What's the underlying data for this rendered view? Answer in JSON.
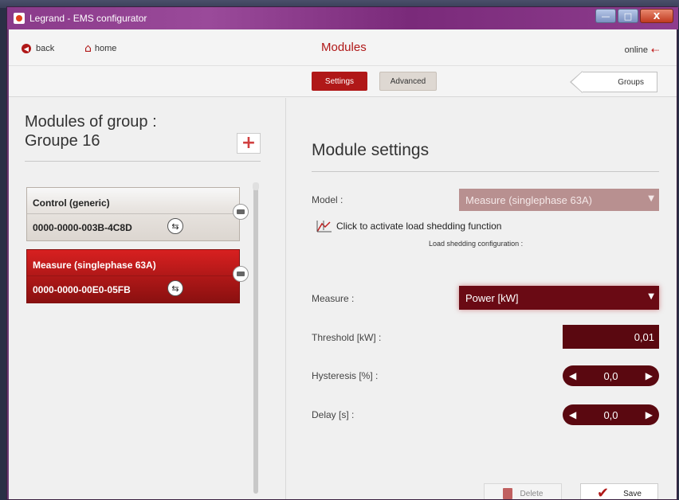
{
  "window": {
    "title": "Legrand - EMS configurator",
    "minimize": "—",
    "maximize": "□",
    "close": "X"
  },
  "topbar": {
    "back_label": "back",
    "home_label": "home",
    "page_title": "Modules",
    "status": "online",
    "tabs": [
      {
        "label": "Settings",
        "active": true
      },
      {
        "label": "Advanced",
        "active": false
      }
    ],
    "groups_label": "Groups"
  },
  "left": {
    "title_line1": "Modules of group :",
    "title_line2": "Groupe  16",
    "add_glyph": "+",
    "modules": [
      {
        "name": "Control (generic)",
        "id": "0000-0000-003B-4C8D",
        "selected": false
      },
      {
        "name": "Measure (singlephase 63A)",
        "id": "0000-0000-00E0-05FB",
        "selected": true
      }
    ]
  },
  "right": {
    "title": "Module settings",
    "model_label": "Model :",
    "model_value": "Measure (singlephase 63A)",
    "shed_link": "Click to activate load shedding function",
    "shed_config": "Load shedding configuration :",
    "measure_label": "Measure :",
    "measure_value": "Power [kW]",
    "threshold_label": "Threshold [kW] :",
    "threshold_value": "0,01",
    "hysteresis_label": "Hysteresis [%] :",
    "hysteresis_value": "0,0",
    "delay_label": "Delay [s] :",
    "delay_value": "0,0",
    "delete_label": "Delete",
    "save_label": "Save"
  },
  "colors": {
    "accent": "#b01818",
    "dark_field": "#5a0810",
    "disabled_field": "#b89090"
  }
}
